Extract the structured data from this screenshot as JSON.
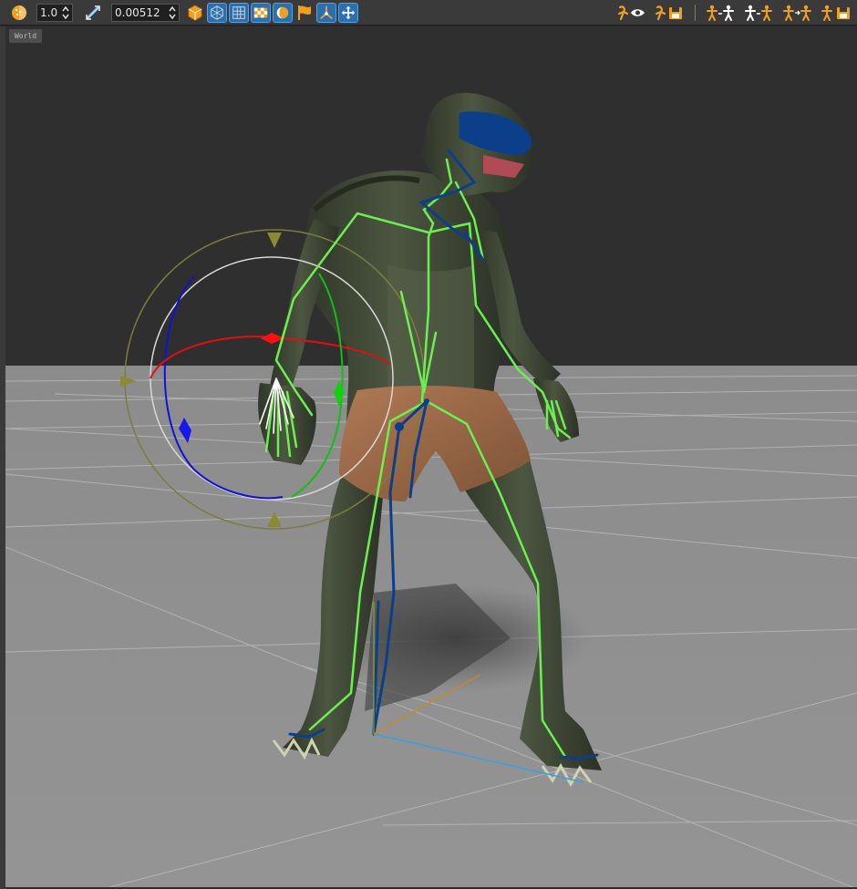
{
  "toolbar": {
    "opacity_value": "1.0",
    "size_value": "0.00512",
    "icons": [
      "transparency-ball-icon",
      "bone-size-icon",
      "display-mesh-icon",
      "wireframe-icon",
      "grid-icon",
      "checker-icon",
      "light-icon",
      "flag-icon",
      "axis-icon",
      "move-cross-icon",
      "motion-preview-icon",
      "motion-save-icon",
      "pose-copy-icon",
      "pose-paste-icon",
      "pose-mirror-icon",
      "pose-save-icon"
    ]
  },
  "viewport": {
    "space_label": "World"
  },
  "colors": {
    "toolbar_bg": "#3a3a3a",
    "active_button": "#2a6fb0",
    "icon_orange": "#f0a020",
    "bone_green": "#6cf050",
    "bone_blue": "#0b3f8a",
    "gizmo_red": "#e01010",
    "gizmo_green": "#10c010",
    "gizmo_blue": "#1010e0",
    "gizmo_yellow": "#8a8a30",
    "floor": "#8e8e8e",
    "sky": "#2f2f2f"
  }
}
